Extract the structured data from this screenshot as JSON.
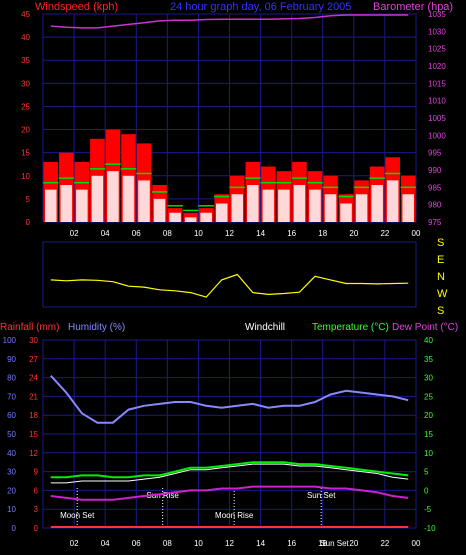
{
  "chart_data": [
    {
      "type": "bar",
      "panel": "wind-pressure",
      "title": "24 hour graph day, 06 February 2005",
      "ylabel_left": "Windspeed (kph)",
      "ylabel_right": "Barometer (hpa)",
      "x_ticks": [
        "02",
        "04",
        "06",
        "08",
        "10",
        "12",
        "14",
        "16",
        "18",
        "20",
        "22",
        "00"
      ],
      "y_left_ticks": [
        0,
        5,
        10,
        15,
        20,
        25,
        30,
        35,
        40,
        45
      ],
      "y_left_range": [
        0,
        45
      ],
      "y_right_ticks": [
        975,
        980,
        985,
        990,
        995,
        1000,
        1005,
        1010,
        1015,
        1020,
        1025,
        1030,
        1035
      ],
      "y_right_range": [
        975,
        1035
      ],
      "gust_hourly": [
        13,
        15,
        13,
        18,
        20,
        19,
        17,
        8,
        3,
        2,
        3,
        6,
        10,
        13,
        12,
        11,
        13,
        11,
        10,
        6,
        9,
        12,
        14,
        10
      ],
      "avg_hourly": [
        7,
        8,
        7,
        10,
        11,
        10,
        9,
        5,
        2,
        1,
        2,
        4,
        6,
        8,
        7,
        7,
        8,
        7,
        6,
        4,
        6,
        8,
        9,
        6
      ],
      "barometer_hourly": [
        1031.5,
        1031.2,
        1031,
        1031,
        1031.5,
        1032,
        1032.5,
        1033,
        1033.2,
        1033.2,
        1033.4,
        1033.5,
        1033.5,
        1033.5,
        1033.5,
        1033.6,
        1033.7,
        1034,
        1034.5,
        1035,
        1035.5,
        1035.8,
        1036,
        1036.2
      ]
    },
    {
      "type": "line",
      "panel": "wind-direction",
      "direction_labels": [
        "S",
        "E",
        "N",
        "W",
        "S"
      ],
      "direction_hourly": [
        150,
        145,
        150,
        148,
        140,
        115,
        110,
        95,
        90,
        80,
        55,
        150,
        180,
        80,
        70,
        75,
        82,
        170,
        150,
        130,
        130,
        128,
        130,
        132
      ]
    },
    {
      "type": "line",
      "panel": "temperature-humidity-rain",
      "ylabel_rain": "Rainfall (mm)",
      "ylabel_humidity": "Humidity (%)",
      "ylabel_windchill": "Windchill",
      "ylabel_temperature": "Temperature (°C)",
      "ylabel_dewpoint": "Dew Point (°C)",
      "y_humidity_ticks": [
        0,
        10,
        20,
        30,
        40,
        50,
        60,
        70,
        80,
        90,
        100
      ],
      "y_rain_ticks": [
        0,
        3,
        6,
        9,
        12,
        15,
        18,
        21,
        24,
        27,
        30
      ],
      "y_temp_ticks": [
        -10,
        -5,
        0,
        5,
        10,
        15,
        20,
        25,
        30,
        35,
        40
      ],
      "y_temp_range": [
        -10,
        40
      ],
      "humidity_hourly": [
        81,
        72,
        61,
        56,
        56,
        63,
        65,
        66,
        67,
        67,
        65,
        64,
        65,
        66,
        64,
        65,
        65,
        67,
        71,
        73,
        72,
        71,
        70,
        68
      ],
      "temperature_hourly": [
        3.5,
        3.5,
        4,
        4,
        3.5,
        3.5,
        4,
        4,
        5,
        6,
        6,
        6.5,
        7,
        7.5,
        7.5,
        7.5,
        7,
        7,
        6.5,
        6,
        5.5,
        5,
        4.5,
        4
      ],
      "dewpoint_hourly": [
        -1.5,
        -2,
        -2.5,
        -2.5,
        -2.5,
        -2,
        -1.5,
        -1,
        -0.5,
        0,
        0,
        0.5,
        0.5,
        1,
        1,
        1,
        1,
        1,
        0.5,
        0.5,
        0,
        -0.5,
        -1.5,
        -2
      ],
      "windchill_hourly": [
        2,
        2,
        2.5,
        2.5,
        2.5,
        2.5,
        3,
        3.5,
        4.5,
        5.5,
        5.5,
        6,
        6.5,
        7,
        7,
        7,
        6.5,
        6.5,
        6,
        5.5,
        5,
        4.5,
        3.5,
        3
      ],
      "rainfall_hourly": [
        0,
        0,
        0,
        0,
        0,
        0,
        0,
        0,
        0,
        0,
        0,
        0,
        0,
        0,
        0,
        0,
        0,
        0,
        0,
        0,
        0,
        0,
        0,
        0
      ],
      "annotations": [
        "Moon Set",
        "Sun Rise",
        "Moon Rise",
        "Sun Set"
      ],
      "annotation_hours": [
        2.2,
        7.7,
        12.3,
        17.9
      ],
      "x_ticks": [
        "02",
        "04",
        "06",
        "08",
        "10",
        "12",
        "14",
        "16",
        "18",
        "20",
        "22",
        "00"
      ],
      "x_last_sub_label": "Sun Set"
    }
  ],
  "colors": {
    "grid": "#1a1a8c",
    "gust": "#ff0000",
    "avg": "#00dd00",
    "white": "#ffffff",
    "barometer": "#cc33cc",
    "direction": "#ffff00",
    "humidity": "#8888ff",
    "temperature": "#00ee00",
    "dewpoint": "#cc22cc",
    "rain": "#ff3333",
    "tick_red": "#ff3333",
    "tick_blue": "#7777ff",
    "tick_green": "#33ff33",
    "tick_magenta": "#dd44dd"
  }
}
